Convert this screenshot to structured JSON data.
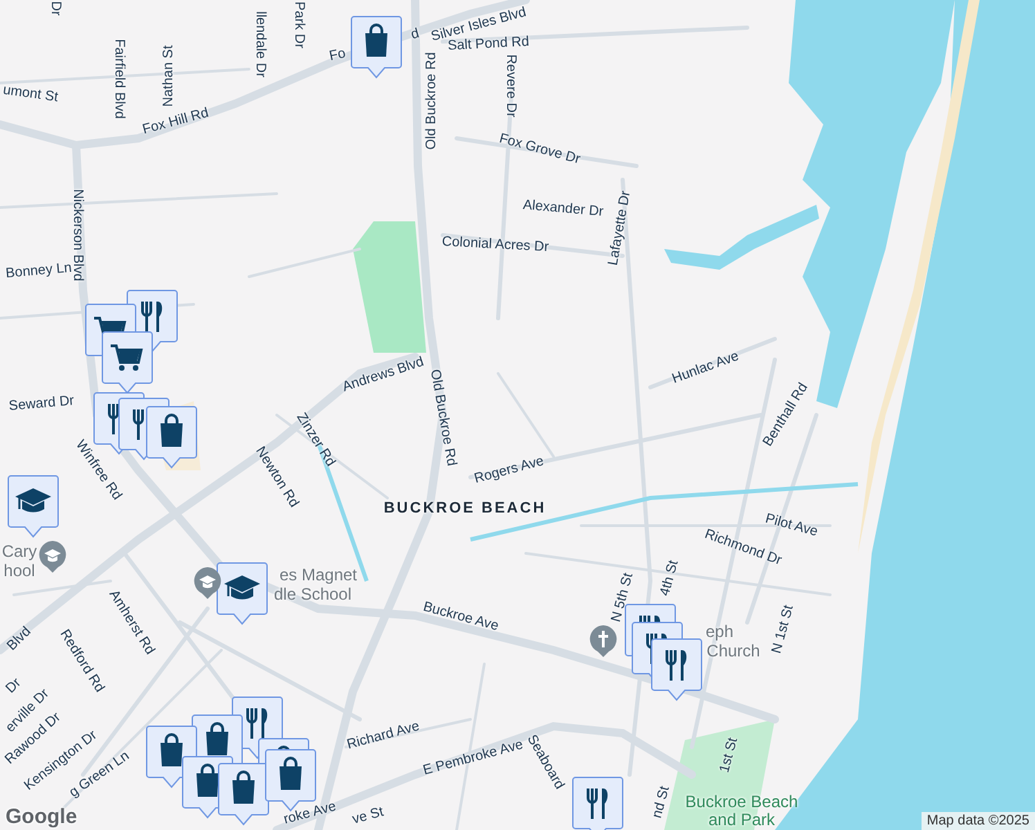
{
  "map": {
    "labels": [
      {
        "text": "Dr",
        "kind": "street"
      },
      {
        "text": "Fairfield Blvd",
        "kind": "street"
      },
      {
        "text": "Nathan St",
        "kind": "street"
      },
      {
        "text": "umont St",
        "kind": "street"
      },
      {
        "text": "llendale Dr",
        "kind": "street"
      },
      {
        "text": "Park Dr",
        "kind": "street"
      },
      {
        "text": "Fox Hill Rd",
        "kind": "street"
      },
      {
        "text": "Fo",
        "kind": "street"
      },
      {
        "text": "d",
        "kind": "street"
      },
      {
        "text": "Silver Isles Blvd",
        "kind": "street"
      },
      {
        "text": "Salt Pond Rd",
        "kind": "street"
      },
      {
        "text": "Old Buckroe Rd",
        "kind": "street"
      },
      {
        "text": "Revere Dr",
        "kind": "street"
      },
      {
        "text": "Fox Grove Dr",
        "kind": "street"
      },
      {
        "text": "Alexander Dr",
        "kind": "street"
      },
      {
        "text": "Lafayette Dr",
        "kind": "street"
      },
      {
        "text": "Colonial Acres Dr",
        "kind": "street"
      },
      {
        "text": "Nickerson Blvd",
        "kind": "street"
      },
      {
        "text": "Bonney Ln",
        "kind": "street"
      },
      {
        "text": "Seward Dr",
        "kind": "street"
      },
      {
        "text": "Andrews Blvd",
        "kind": "street"
      },
      {
        "text": "Old Buckroe Rd",
        "kind": "street"
      },
      {
        "text": "Hunlac Ave",
        "kind": "street"
      },
      {
        "text": "Benthall Rd",
        "kind": "street"
      },
      {
        "text": "Zinzer Rd",
        "kind": "street"
      },
      {
        "text": "Newton Rd",
        "kind": "street"
      },
      {
        "text": "Winfree Rd",
        "kind": "street"
      },
      {
        "text": "Rogers Ave",
        "kind": "street"
      },
      {
        "text": "BUCKROE BEACH",
        "kind": "district"
      },
      {
        "text": "Cary",
        "kind": "poi"
      },
      {
        "text": "hool",
        "kind": "poi"
      },
      {
        "text": "es Magnet",
        "kind": "poi"
      },
      {
        "text": "dle School",
        "kind": "poi"
      },
      {
        "text": "Buckroe Ave",
        "kind": "street"
      },
      {
        "text": "Amherst Rd",
        "kind": "street"
      },
      {
        "text": "Redford Rd",
        "kind": "street"
      },
      {
        "text": "Blvd",
        "kind": "street"
      },
      {
        "text": "Dr",
        "kind": "street"
      },
      {
        "text": "erville Dr",
        "kind": "street"
      },
      {
        "text": "Rawood Dr",
        "kind": "street"
      },
      {
        "text": "Kensington Dr",
        "kind": "street"
      },
      {
        "text": "g Green Ln",
        "kind": "street"
      },
      {
        "text": "Richard Ave",
        "kind": "street"
      },
      {
        "text": "E Pembroke Ave",
        "kind": "street"
      },
      {
        "text": "Seaboard",
        "kind": "street"
      },
      {
        "text": "N 5th St",
        "kind": "street"
      },
      {
        "text": "4th St",
        "kind": "street"
      },
      {
        "text": "eph",
        "kind": "poi"
      },
      {
        "text": "Church",
        "kind": "poi"
      },
      {
        "text": "Pilot Ave",
        "kind": "street"
      },
      {
        "text": "Richmond Dr",
        "kind": "street"
      },
      {
        "text": "N 1st St",
        "kind": "street"
      },
      {
        "text": "1st St",
        "kind": "street"
      },
      {
        "text": "nd St",
        "kind": "street"
      },
      {
        "text": "Buckroe Beach",
        "kind": "park"
      },
      {
        "text": "and Park",
        "kind": "park"
      },
      {
        "text": "roke Ave",
        "kind": "street"
      },
      {
        "text": "ve St",
        "kind": "street"
      }
    ],
    "pois": [
      {
        "kind": "school"
      },
      {
        "kind": "school"
      },
      {
        "kind": "church"
      }
    ],
    "markers": [
      {
        "kind": "shopping"
      },
      {
        "kind": "restaurant"
      },
      {
        "kind": "grocery"
      },
      {
        "kind": "grocery"
      },
      {
        "kind": "restaurant"
      },
      {
        "kind": "restaurant"
      },
      {
        "kind": "shopping"
      },
      {
        "kind": "school"
      },
      {
        "kind": "school"
      },
      {
        "kind": "restaurant"
      },
      {
        "kind": "shopping"
      },
      {
        "kind": "shopping"
      },
      {
        "kind": "shopping"
      },
      {
        "kind": "shopping"
      },
      {
        "kind": "shopping"
      },
      {
        "kind": "shopping"
      },
      {
        "kind": "restaurant"
      },
      {
        "kind": "restaurant"
      },
      {
        "kind": "restaurant"
      },
      {
        "kind": "restaurant"
      }
    ],
    "logo": "Google",
    "attribution": "Map data ©2025"
  }
}
